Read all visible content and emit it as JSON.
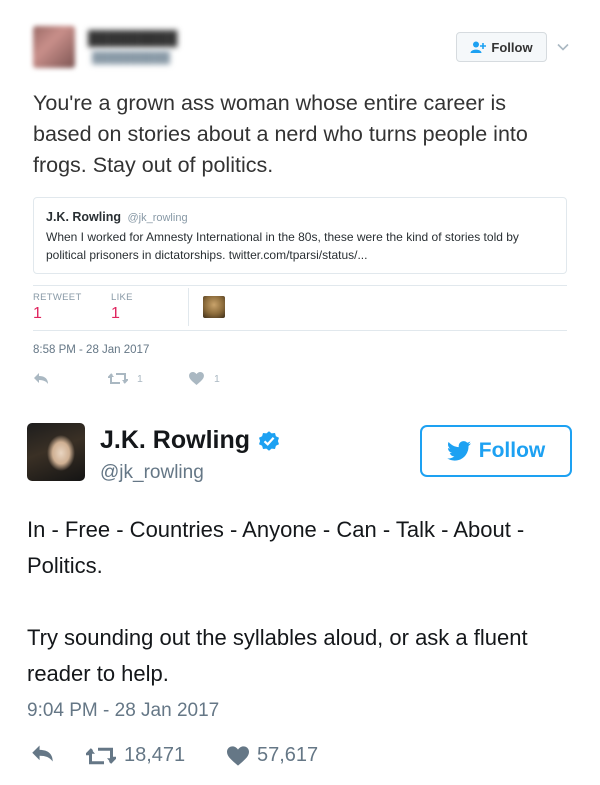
{
  "tweet1": {
    "follow_label": "Follow",
    "text": "You're a grown ass woman whose entire career is based on stories about a nerd who turns people into frogs. Stay out of politics.",
    "quote": {
      "name": "J.K. Rowling",
      "handle": "@jk_rowling",
      "text": "When I worked for Amnesty International in the 80s, these were the kind of stories told by political prisoners in dictatorships. twitter.com/tparsi/status/..."
    },
    "retweet_label": "RETWEET",
    "retweet_count": "1",
    "like_label": "LIKE",
    "like_count": "1",
    "timestamp": "8:58 PM - 28 Jan 2017",
    "actions": {
      "retweets": "1",
      "likes": "1"
    }
  },
  "tweet2": {
    "name": "J.K. Rowling",
    "handle": "@jk_rowling",
    "follow_label": "Follow",
    "text_para1": "In - Free - Countries - Anyone - Can - Talk - About - Politics.",
    "text_para2": "Try sounding out the syllables aloud, or ask a fluent reader to help.",
    "timestamp": "9:04 PM - 28 Jan 2017",
    "actions": {
      "retweets": "18,471",
      "likes": "57,617"
    }
  },
  "colors": {
    "twitter_blue": "#1da1f2",
    "like_pink": "#e0245e",
    "muted": "#657786"
  },
  "icons": [
    "follow-person-icon",
    "chevron-down-icon",
    "reply-icon",
    "retweet-icon",
    "heart-icon",
    "verified-badge-icon",
    "twitter-bird-icon"
  ]
}
